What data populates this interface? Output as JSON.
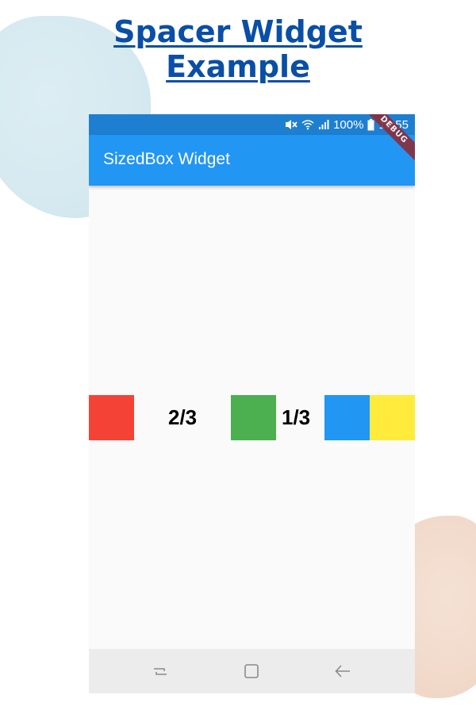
{
  "heading": {
    "line1": "Spacer Widget ",
    "line2": "Example"
  },
  "status_bar": {
    "battery": "100%",
    "time": "13:55",
    "icons": [
      "mute-icon",
      "wifi-icon",
      "signal-icon",
      "battery-icon"
    ]
  },
  "app_bar": {
    "title": "SizedBox Widget",
    "debug_banner": "DEBUG"
  },
  "body": {
    "row": [
      {
        "type": "box",
        "color": "#f44336"
      },
      {
        "type": "label",
        "text": "2/3"
      },
      {
        "type": "box",
        "color": "#4caf50"
      },
      {
        "type": "label",
        "text": "1/3"
      },
      {
        "type": "box",
        "color": "#2196f3"
      },
      {
        "type": "box",
        "color": "#ffeb3b"
      }
    ]
  },
  "nav_bar": {
    "icons": [
      "recent-apps-icon",
      "home-icon",
      "back-icon"
    ]
  },
  "colors": {
    "heading": "#0a4fa6",
    "status_bar": "#1e7fd0",
    "app_bar": "#2196f3",
    "background": "#fafafa",
    "nav_bar": "#ececec"
  }
}
